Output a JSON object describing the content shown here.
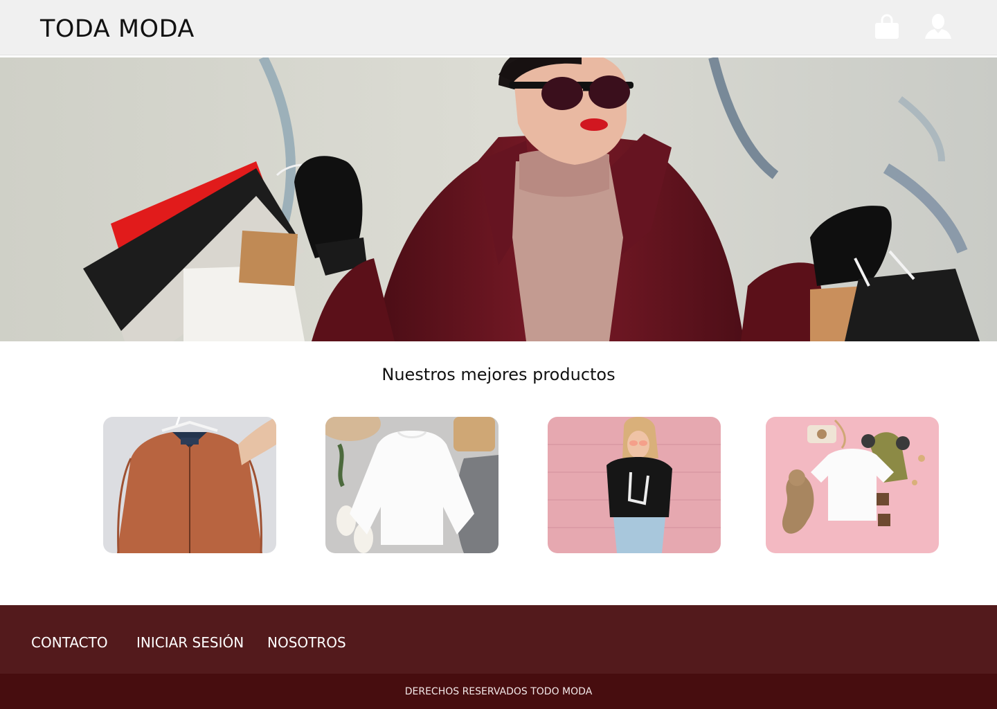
{
  "header": {
    "brand": "TODA MODA",
    "cart_icon": "shopping-bag-icon",
    "user_icon": "user-icon"
  },
  "hero": {
    "image": "woman-with-shopping-bags"
  },
  "products": {
    "title": "Nuestros mejores productos",
    "items": [
      {
        "image": "rust-bomber-jacket"
      },
      {
        "image": "white-sweatshirt-flatlay"
      },
      {
        "image": "woman-skeleton-hand-tee"
      },
      {
        "image": "kids-white-tee-flatlay"
      }
    ]
  },
  "footer": {
    "links": [
      "CONTACTO",
      "INICIAR SESIÓN",
      "NOSOTROS"
    ],
    "copyright": "DERECHOS RESERVADOS TODO MODA"
  },
  "colors": {
    "header_bg": "#f0f0f0",
    "footer_nav_bg": "#531a1c",
    "footer_bottom_bg": "#470d0f",
    "text": "#111111"
  }
}
